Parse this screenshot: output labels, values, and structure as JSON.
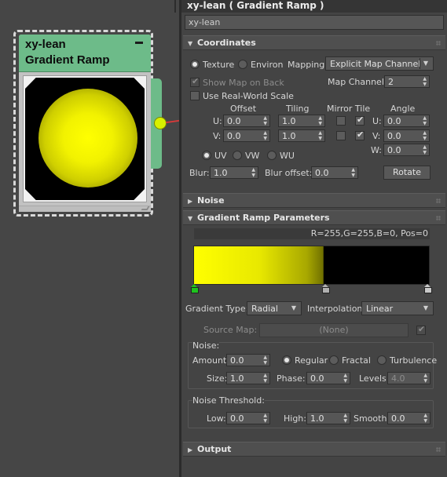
{
  "node": {
    "name": "xy-lean",
    "type": "Gradient Ramp",
    "accent": "#6dbb89",
    "socket_color": "#d8f000",
    "wire_color": "#d63a3a"
  },
  "panel": {
    "title": "xy-lean  ( Gradient Ramp )",
    "name_value": "xy-lean"
  },
  "coordinates": {
    "header": "Coordinates",
    "texture_label": "Texture",
    "environ_label": "Environ",
    "mapping_label": "Mapping:",
    "mapping_value": "Explicit Map Channel",
    "show_map_label": "Show Map on Back",
    "map_channel_label": "Map Channel:",
    "map_channel_value": "2",
    "real_world_label": "Use Real-World Scale",
    "col_offset": "Offset",
    "col_tiling": "Tiling",
    "col_mirror_tile": "Mirror Tile",
    "col_angle": "Angle",
    "u_label": "U:",
    "v_label": "V:",
    "w_label": "W:",
    "offset_u": "0.0",
    "offset_v": "0.0",
    "tiling_u": "1.0",
    "tiling_v": "1.0",
    "angle_u": "0.0",
    "angle_v": "0.0",
    "angle_w": "0.0",
    "uv_label": "UV",
    "vw_label": "VW",
    "wu_label": "WU",
    "blur_label": "Blur:",
    "blur_value": "1.0",
    "blur_offset_label": "Blur offset:",
    "blur_offset_value": "0.0",
    "rotate_label": "Rotate"
  },
  "noise_section": {
    "header": "Noise"
  },
  "gradient": {
    "header": "Gradient Ramp Parameters",
    "flag_info": "R=255,G=255,B=0, Pos=0",
    "gradient_type_label": "Gradient Type:",
    "gradient_type_value": "Radial",
    "interpolation_label": "Interpolation:",
    "interpolation_value": "Linear",
    "source_map_label": "Source Map:",
    "source_map_value": "(None)",
    "ramp_colors": [
      "#ffff00",
      "#000000"
    ],
    "flag_colors": [
      "#1ec31e",
      "#b0b0b0",
      "#c8c8c8"
    ]
  },
  "noise_params": {
    "group_label": "Noise:",
    "amount_label": "Amount:",
    "amount_value": "0.0",
    "regular_label": "Regular",
    "fractal_label": "Fractal",
    "turbulence_label": "Turbulence",
    "size_label": "Size:",
    "size_value": "1.0",
    "phase_label": "Phase:",
    "phase_value": "0.0",
    "levels_label": "Levels:",
    "levels_value": "4.0"
  },
  "noise_threshold": {
    "group_label": "Noise Threshold:",
    "low_label": "Low:",
    "low_value": "0.0",
    "high_label": "High:",
    "high_value": "1.0",
    "smooth_label": "Smooth:",
    "smooth_value": "0.0"
  },
  "output_section": {
    "header": "Output"
  }
}
